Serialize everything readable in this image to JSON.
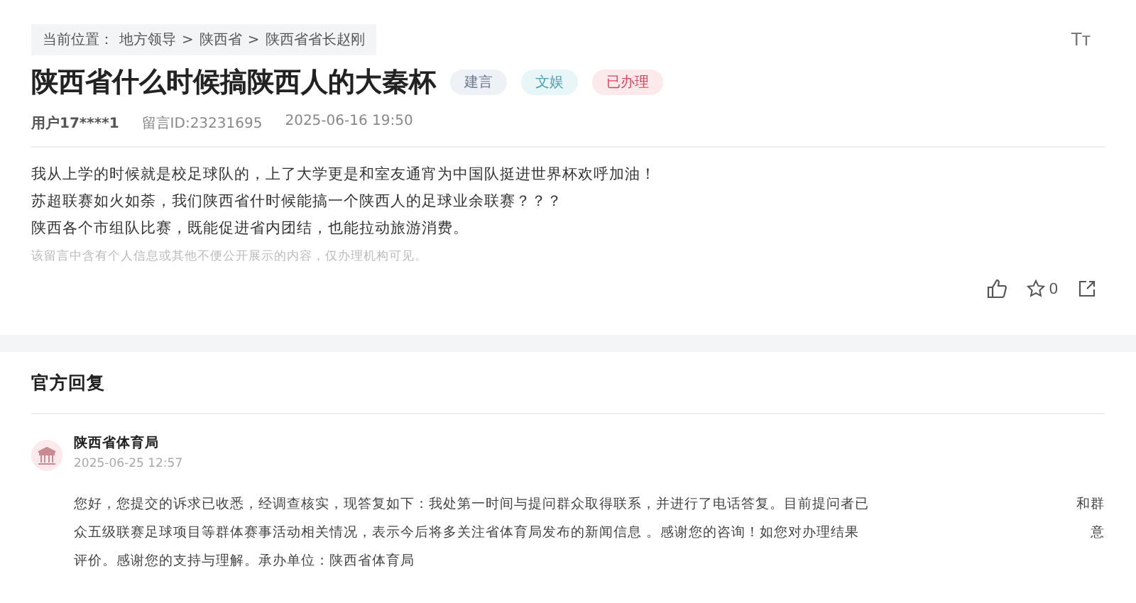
{
  "breadcrumb": {
    "label": "当前位置：",
    "items": [
      "地方领导",
      "陕西省",
      "陕西省省长赵刚"
    ],
    "separator": ">"
  },
  "font_size_button": "Tт",
  "title": "陕西省什么时候搞陕西人的大秦杯",
  "tags": [
    {
      "label": "建言",
      "color": "#eef1f6",
      "kind": "type"
    },
    {
      "label": "文娱",
      "color": "#e9f6f8",
      "kind": "category"
    },
    {
      "label": "已办理",
      "color": "#fbe9ec",
      "kind": "status"
    }
  ],
  "meta": {
    "user": "用户17****1",
    "message_id": "留言ID:23231695",
    "time": "2025-06-16 19:50"
  },
  "body": [
    "我从上学的时候就是校足球队的，上了大学更是和室友通宵为中国队挺进世界杯欢呼加油！",
    "苏超联赛如火如荼，我们陕西省什时候能搞一个陕西人的足球业余联赛？？？",
    "陕西各个市组队比赛，既能促进省内团结，也能拉动旅游消费。"
  ],
  "privacy_note": "该留言中含有个人信息或其他不便公开展示的内容，仅办理机构可见。",
  "actions": {
    "liked": false,
    "favorited": false,
    "favorite_count": "0"
  },
  "reply": {
    "heading": "官方回复",
    "org": "陕西省体育局",
    "time": "2025-06-25 12:57",
    "lines": [
      [
        "您好，您提交的诉求已收悉，经调查核实，现答复如下：我处第一时间与提问群众取得联系，并进行了电话答复。目前提问者已",
        "和群"
      ],
      [
        "众五级联赛足球项目等群体赛事活动相关情况，表示今后将多关注省体育局发布的新闻信息 。感谢您的咨询！如您对办理结果",
        "意"
      ],
      [
        "评价。感谢您的支持与理解。承办单位：陕西省体育局"
      ]
    ]
  }
}
